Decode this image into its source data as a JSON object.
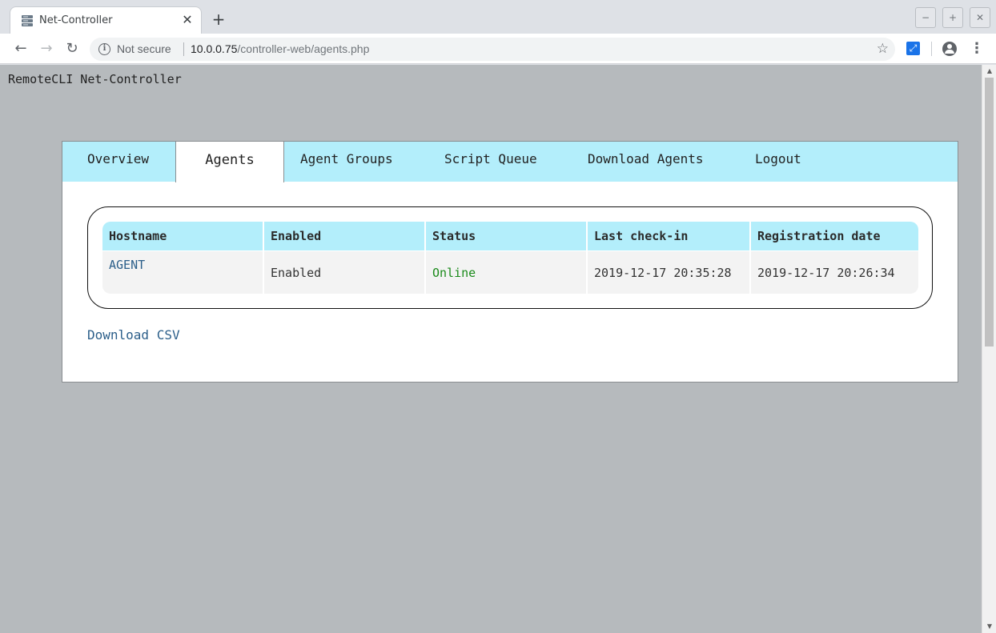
{
  "browser": {
    "tab_title": "Net-Controller",
    "tab_close": "✕",
    "new_tab": "+",
    "security_label": "Not secure",
    "url_host": "10.0.0.75",
    "url_path": "/controller-web/agents.php",
    "window_controls": {
      "minimize": "−",
      "maximize": "+",
      "close": "✕"
    }
  },
  "page": {
    "site_title": "RemoteCLI Net-Controller",
    "nav_tabs": [
      {
        "label": "Overview",
        "active": false
      },
      {
        "label": "Agents",
        "active": true
      },
      {
        "label": "Agent Groups",
        "active": false
      },
      {
        "label": "Script Queue",
        "active": false
      },
      {
        "label": "Download Agents",
        "active": false
      },
      {
        "label": "Logout",
        "active": false
      }
    ],
    "table": {
      "headers": [
        "Hostname",
        "Enabled",
        "Status",
        "Last check-in",
        "Registration date"
      ],
      "rows": [
        {
          "hostname": "AGENT",
          "enabled": "Enabled",
          "status": "Online",
          "last_checkin": "2019-12-17 20:35:28",
          "registration_date": "2019-12-17 20:26:34"
        }
      ]
    },
    "download_csv": "Download CSV"
  },
  "colors": {
    "tab_background": "#b3eefb",
    "page_background": "#b6babd",
    "link": "#2c5f8a",
    "status_online": "#1a8a1a"
  }
}
